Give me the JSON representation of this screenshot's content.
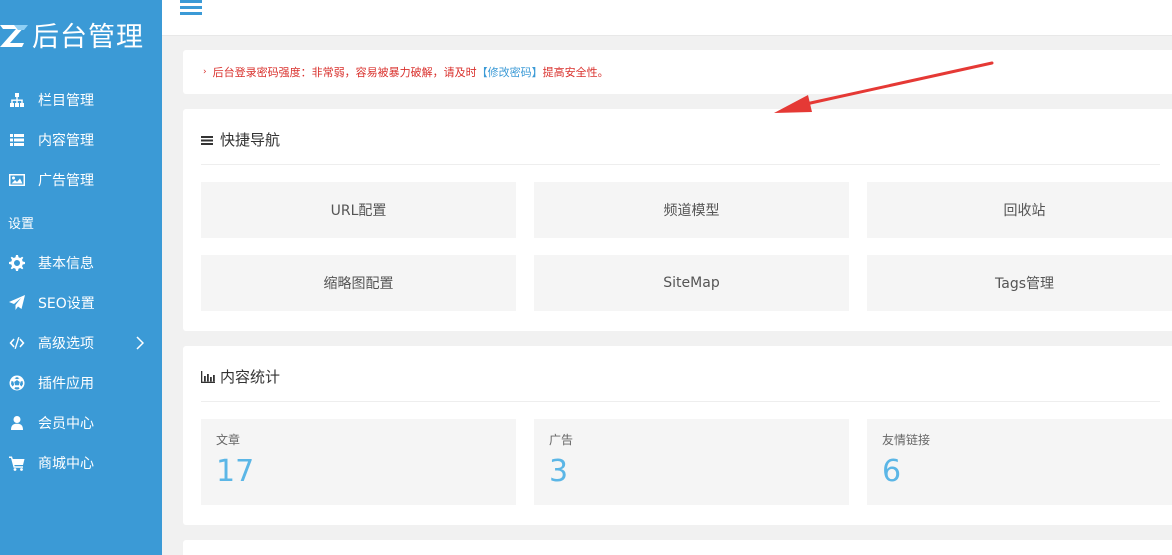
{
  "app": {
    "logo_text": "后台管理"
  },
  "sidebar": {
    "items": [
      {
        "label": "栏目管理",
        "icon": "sitemap-icon"
      },
      {
        "label": "内容管理",
        "icon": "list-icon"
      },
      {
        "label": "广告管理",
        "icon": "image-icon"
      }
    ],
    "section_title": "设置",
    "settings_items": [
      {
        "label": "基本信息",
        "icon": "gear-icon"
      },
      {
        "label": "SEO设置",
        "icon": "paper-plane-icon"
      },
      {
        "label": "高级选项",
        "icon": "code-icon"
      },
      {
        "label": "插件应用",
        "icon": "soccer-ball-icon"
      },
      {
        "label": "会员中心",
        "icon": "user-icon"
      },
      {
        "label": "商城中心",
        "icon": "cart-icon"
      }
    ]
  },
  "alert": {
    "text_before": "后台登录密码强度：非常弱，容易被暴力破解，请及时",
    "link": "【修改密码】",
    "text_after": "提高安全性。"
  },
  "quick_nav": {
    "title": "快捷导航",
    "items": [
      "URL配置",
      "频道模型",
      "回收站",
      "缩略图配置",
      "SiteMap",
      "Tags管理"
    ]
  },
  "stats": {
    "title": "内容统计",
    "items": [
      {
        "label": "文章",
        "value": "17"
      },
      {
        "label": "广告",
        "value": "3"
      },
      {
        "label": "友情链接",
        "value": "6"
      }
    ]
  },
  "colors": {
    "sidebar": "#3b9ad6",
    "alert": "#d9302c",
    "stat_value": "#5bb6e6",
    "arrow": "#e53935"
  }
}
